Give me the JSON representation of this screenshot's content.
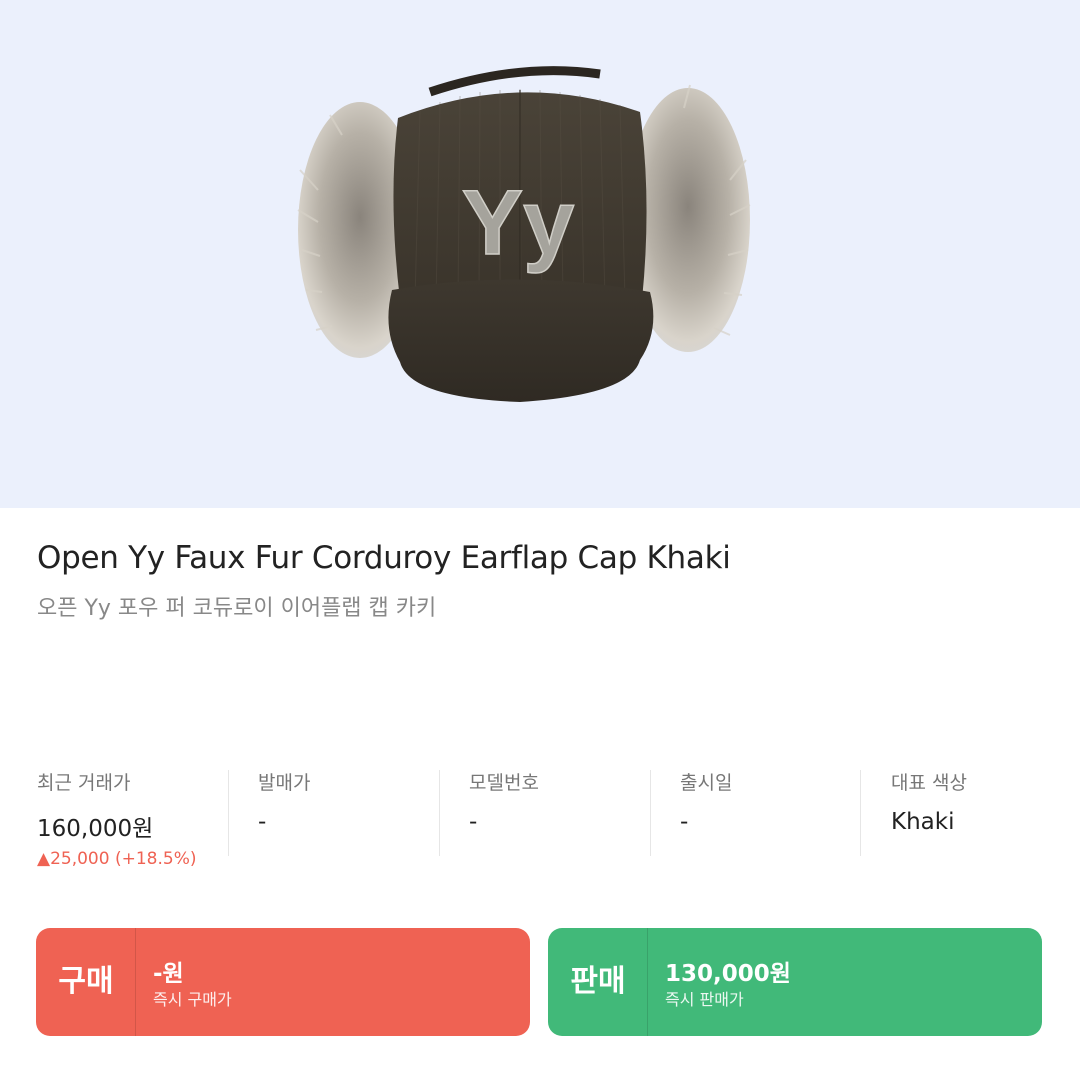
{
  "product": {
    "name_en": "Open Yy Faux Fur Corduroy Earflap Cap Khaki",
    "name_ko": "오픈 Yy 포우 퍼 코듀로이 이어플랩 캡 카키",
    "image_logo_text": "Yy"
  },
  "specs": [
    {
      "label": "최근 거래가",
      "value": "160,000원",
      "change": "▲25,000 (+18.5%)"
    },
    {
      "label": "발매가",
      "value": "-"
    },
    {
      "label": "모델번호",
      "value": "-"
    },
    {
      "label": "출시일",
      "value": "-"
    },
    {
      "label": "대표 색상",
      "value": "Khaki"
    }
  ],
  "buttons": {
    "buy": {
      "label": "구매",
      "price": "-원",
      "sub": "즉시 구매가",
      "color": "#ef6253"
    },
    "sell": {
      "label": "판매",
      "price": "130,000원",
      "sub": "즉시 판매가",
      "color": "#41b979"
    }
  },
  "colors": {
    "hero_bg": "#ebf0fc",
    "change_up": "#ef6253"
  }
}
